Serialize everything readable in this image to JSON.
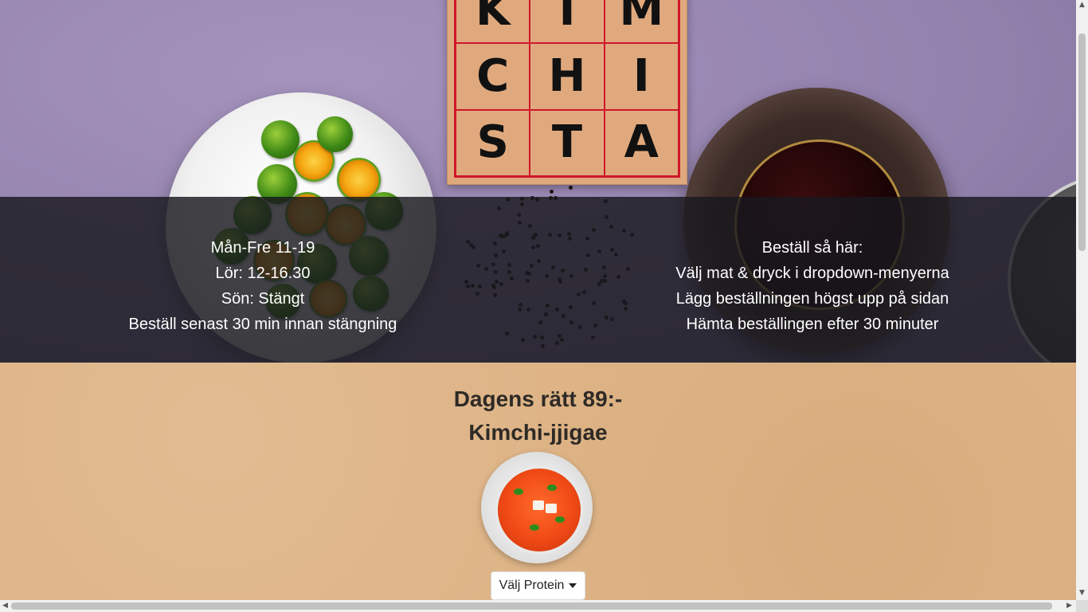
{
  "logo": {
    "cells": [
      "K",
      "I",
      "M",
      "C",
      "H",
      "I",
      "S",
      "T",
      "A"
    ]
  },
  "hours": {
    "lines": [
      "Mån-Fre 11-19",
      "Lör: 12-16.30",
      "Sön: Stängt",
      "Beställ senast 30 min innan stängning"
    ]
  },
  "how_to_order": {
    "lines": [
      "Beställ så här:",
      "Välj mat & dryck i dropdown-menyerna",
      "Lägg beställningen högst upp på sidan",
      "Hämta beställingen efter 30 minuter"
    ]
  },
  "daily_dish": {
    "title": "Dagens rätt 89:-",
    "name": "Kimchi-jjigae"
  },
  "protein_dropdown": {
    "label": "Välj Protein"
  },
  "colors": {
    "hero_background": "#9382ad",
    "logo_background": "#e0a97d",
    "logo_grid": "#d0172a",
    "info_band": "#19191e",
    "lower_background": "#deb486",
    "heading_text": "#2e2a26"
  },
  "icons": {
    "dropdown_caret": "caret-down-icon",
    "scroll_up": "scroll-up-arrow-icon",
    "scroll_down": "scroll-down-arrow-icon",
    "scroll_left": "scroll-left-arrow-icon",
    "scroll_right": "scroll-right-arrow-icon"
  }
}
